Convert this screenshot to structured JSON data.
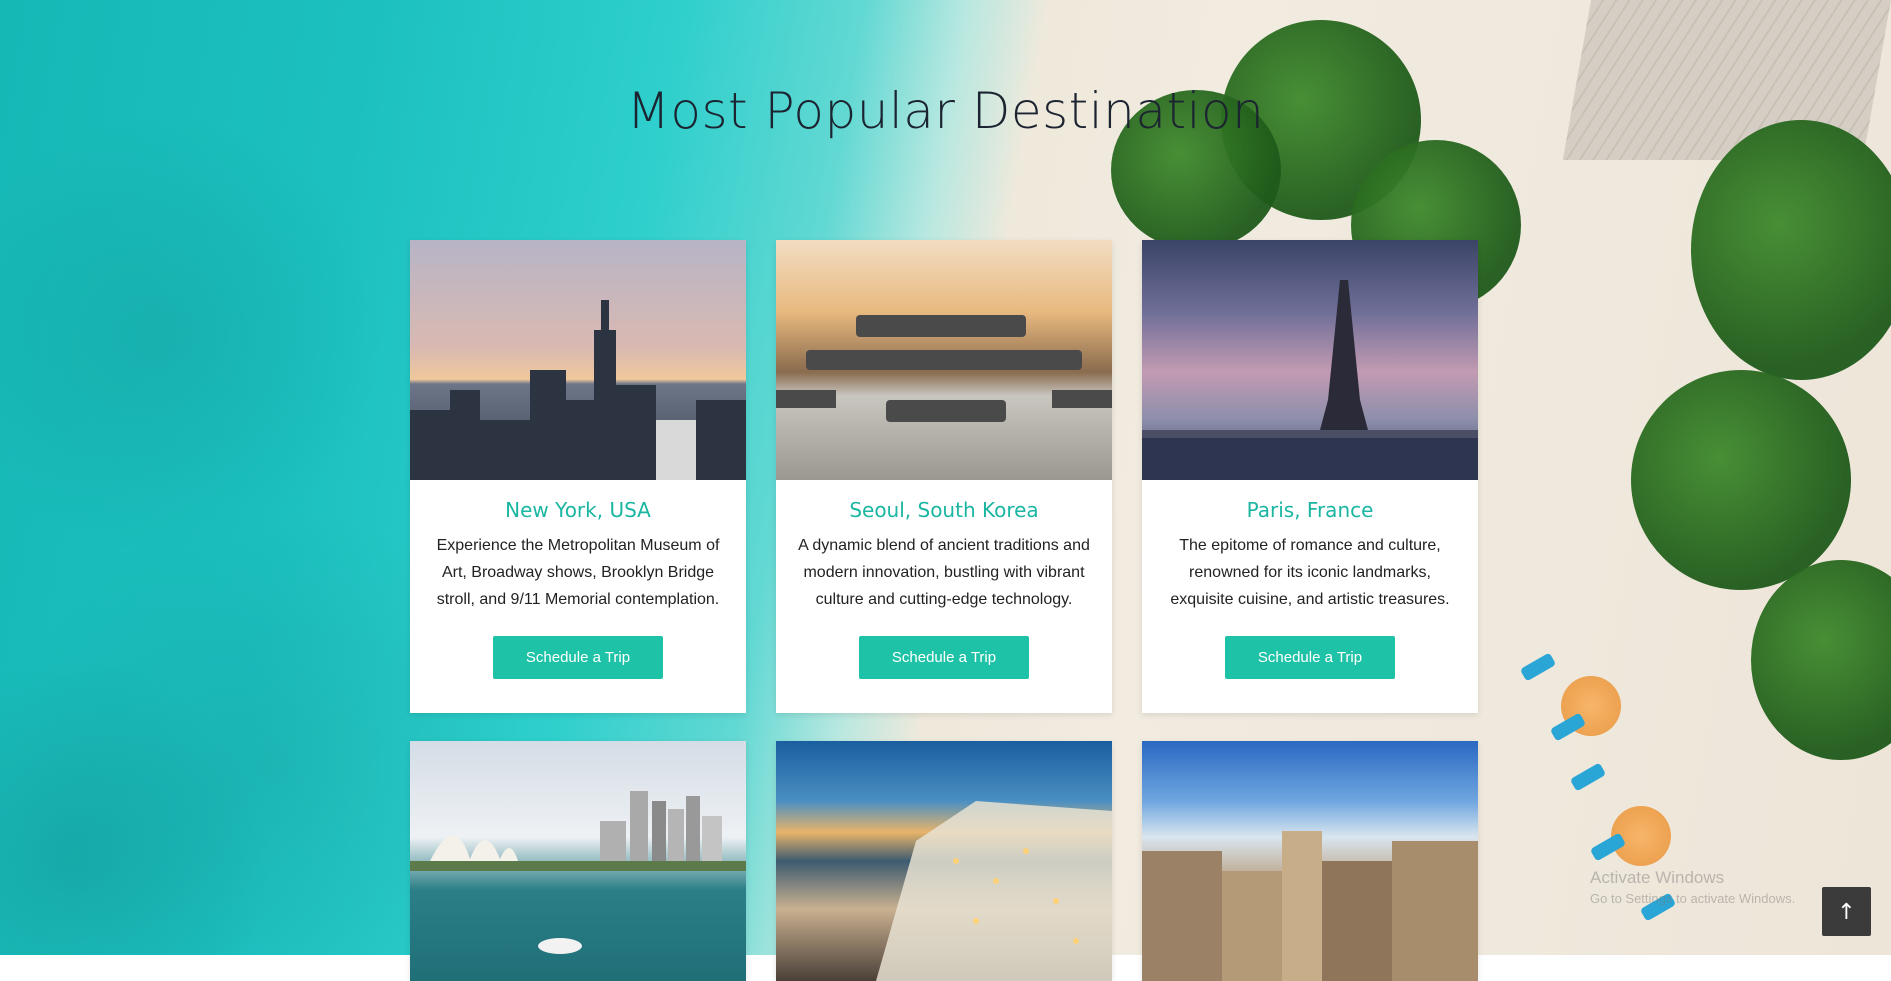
{
  "page": {
    "title": "Most Popular Destination"
  },
  "cards": [
    {
      "city": "New York, USA",
      "description": "Experience the Metropolitan Museum of Art, Broadway shows, Brooklyn Bridge stroll, and 9/11 Memorial contemplation.",
      "button": "Schedule a Trip"
    },
    {
      "city": "Seoul, South Korea",
      "description": "A dynamic blend of ancient traditions and modern innovation, bustling with vibrant culture and cutting-edge technology.",
      "button": "Schedule a Trip"
    },
    {
      "city": "Paris, France",
      "description": "The epitome of romance and culture, renowned for its iconic landmarks, exquisite cuisine, and artistic treasures.",
      "button": "Schedule a Trip"
    }
  ],
  "colors": {
    "accent": "#1ec2a6",
    "heading": "#1ab6a2"
  },
  "scroll_top": {
    "icon": "arrow-up-icon"
  },
  "watermark": {
    "line1": "Activate Windows",
    "line2": "Go to Settings to activate Windows."
  }
}
